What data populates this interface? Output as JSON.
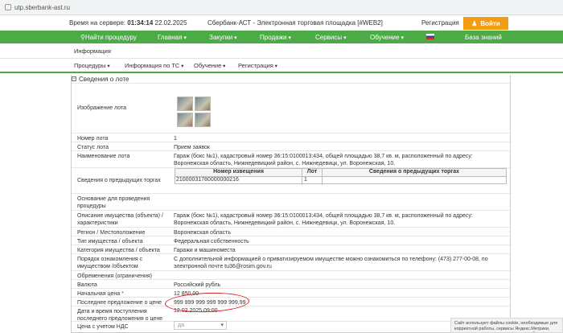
{
  "browser": {
    "url": "utp.sberbank-ast.ru"
  },
  "header": {
    "server_time_label": "Время на сервере:",
    "server_time": "01:34:14",
    "server_date": "22.02.2025",
    "site_title": "Сбербанк-АСТ - Электронная торговая площадка [#WEB2]",
    "register_label": "Регистрация",
    "login_label": "Войти"
  },
  "mainnav": {
    "find": "Найти процедуру",
    "main": "Главная",
    "purchases": "Закупки",
    "sales": "Продажи",
    "services": "Сервисы",
    "training": "Обучение",
    "knowledge": "База знаний"
  },
  "subnav": {
    "info": "Информация",
    "procedures": "Процедуры",
    "info_ts": "Информация по ТС",
    "training": "Обучение",
    "registration": "Регистрация"
  },
  "lot": {
    "section_title": "Сведения о лоте",
    "image_label": "Изображение лота",
    "number_label": "Номер лота",
    "number": "1",
    "status_label": "Статус лота",
    "status": "Прием заявок",
    "name_label": "Наименование лота",
    "name": "Гараж (бокс №1), кадастровый номер 36:15:0100013:434, общей площадью 38,7 кв. м, расположенный по адресу: Воронежская область, Нижнедевицкий район, с. Нижнедевицк, ул. Воронежская, 10.",
    "prev_label": "Сведения о предыдущих торгах",
    "prev_table": {
      "h_notice": "Номер извещения",
      "h_lot": "Лот",
      "h_info": "Сведения о предыдущих торгах",
      "notice": "21000031780000000216",
      "lot": "1",
      "info": ""
    },
    "basis_label": "Основание для проведения процедуры",
    "basis": "",
    "description_label": "Описание имущества (объекта) / характеристики",
    "description": "Гараж (бокс №1), кадастровый номер 36:15:0100013:434, общей площадью 38,7 кв. м, расположенный по адресу: Воронежская область, Нижнедевицкий район, с. Нижнедевицк, ул. Воронежская, 10.",
    "region_label": "Регион / Местоположение",
    "region": "Воронежская область",
    "property_type_label": "Тип имущества / объекта",
    "property_type": "Федеральная собственность",
    "category_label": "Категория имущества / объекта",
    "category": "Гаражи и машиноместа",
    "inspection_label": "Порядок ознакомления с имуществом /объектом",
    "inspection": "С дополнительной информацией о приватизируемом имуществе можно ознакомиться по телефону: (473) 277-00-08, по электронной почте tu36@rosim.gov.ru",
    "encumbrance_label": "Обременения (ограничения)",
    "encumbrance": "",
    "currency_label": "Валюта",
    "currency": "Российский рубль",
    "start_price_label": "Начальная цена",
    "start_price_required": "*",
    "start_price": "12 850,00",
    "last_offer_label": "Последнее предложение о цене",
    "last_offer": "999 999 999 999 999 999,99",
    "receipt_label": "Дата и время поступления последнего предложения о цене",
    "receipt": "12.02.2025 09:00",
    "vat_label": "Цена с учетом НДС",
    "vat": "да"
  },
  "cookie": {
    "text": "Сайт использует файлы cookie, необходимые для корректной работы, сервисы Яндекс.Метрики, используемые для анализа посещений"
  },
  "colors": {
    "brand_green": "#4caa47",
    "login_orange": "#f39c12",
    "annotation_red": "#d6242a"
  }
}
